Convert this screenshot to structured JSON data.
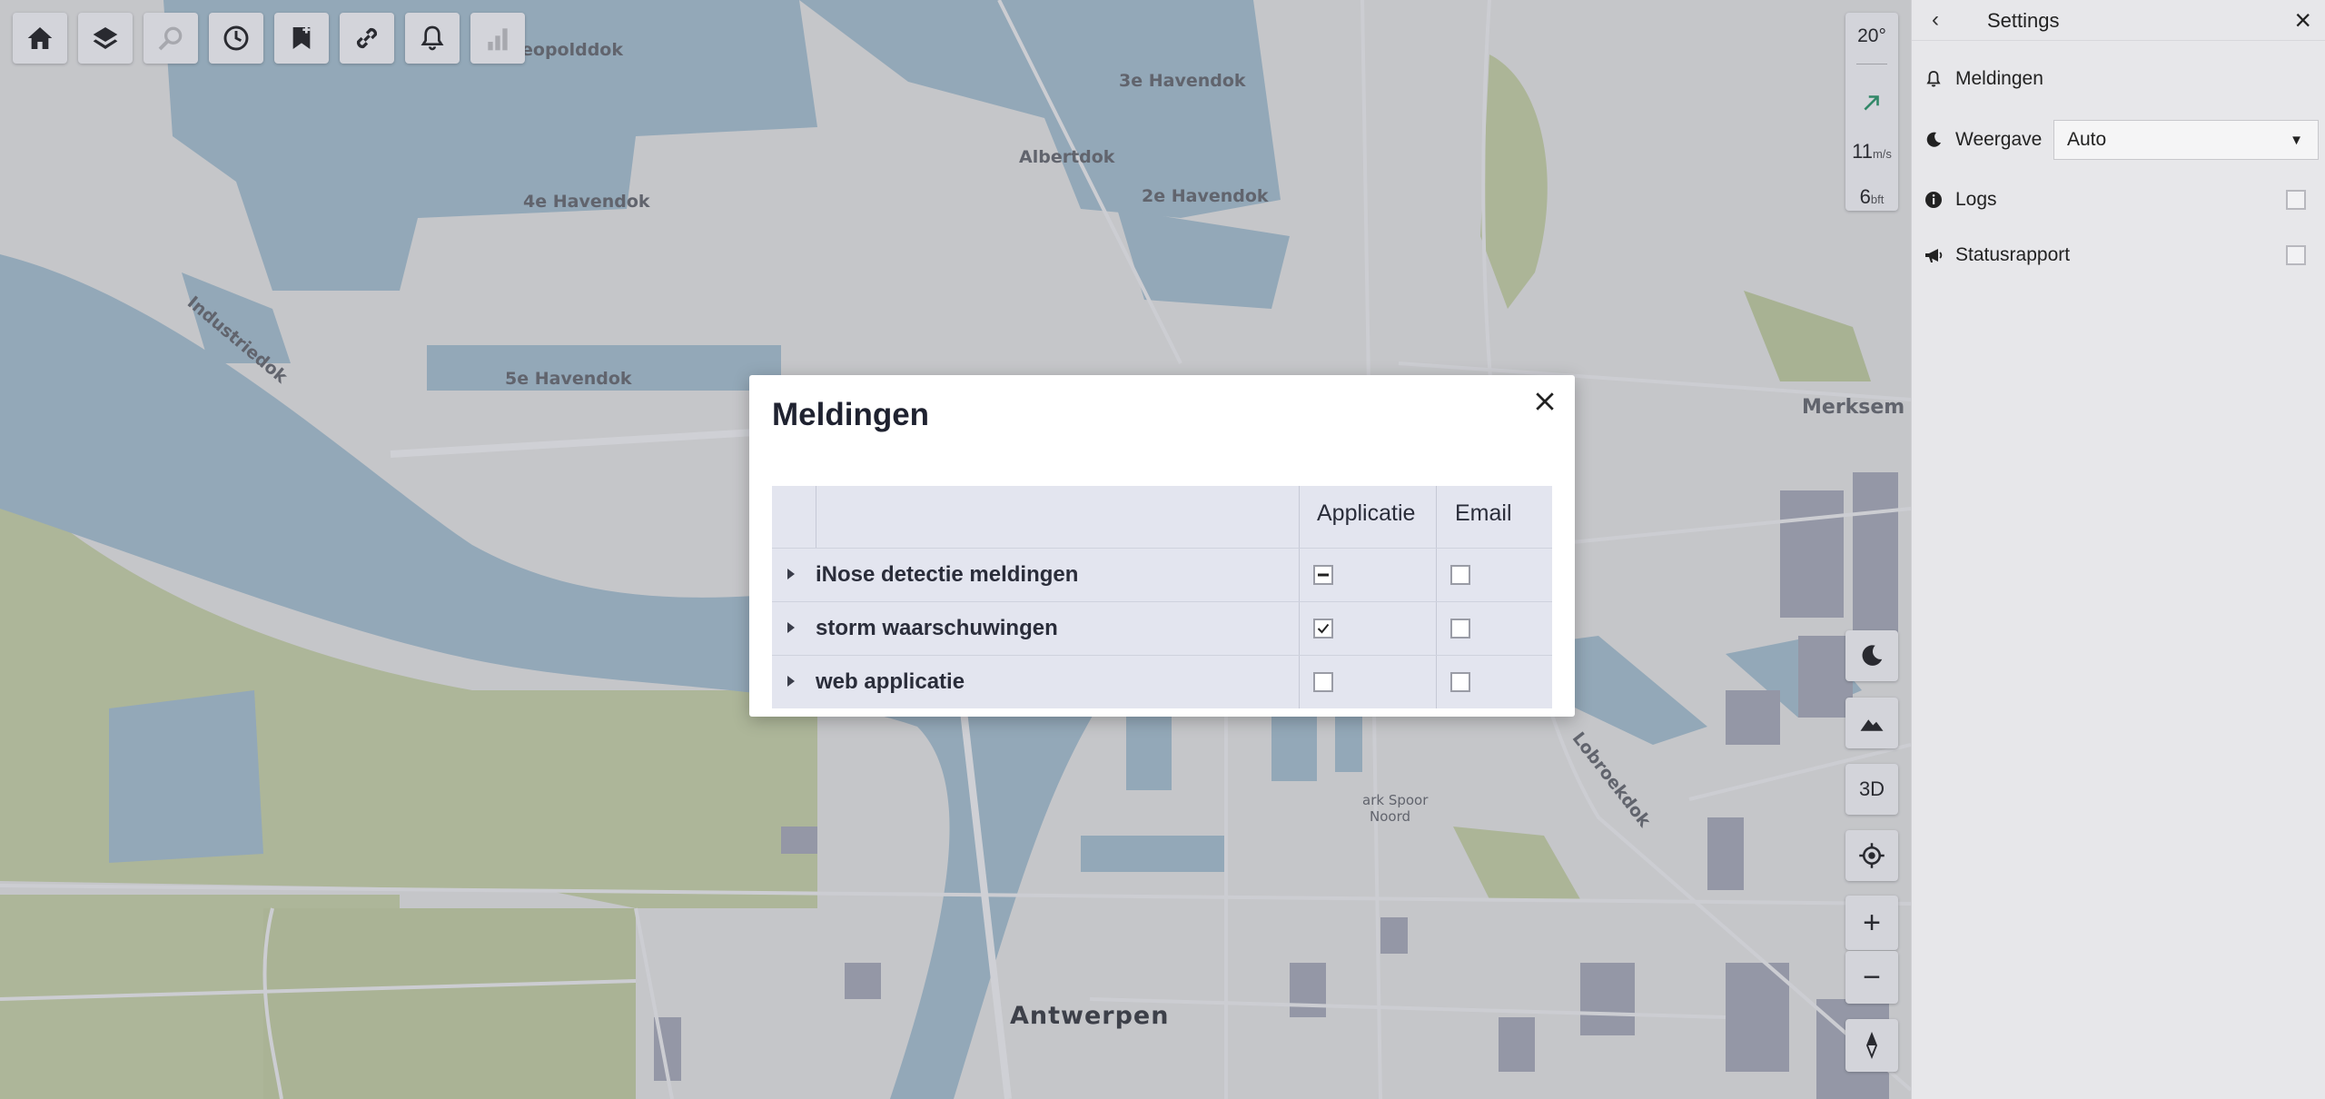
{
  "toolbar": {
    "buttons": [
      {
        "name": "home-icon",
        "enabled": true
      },
      {
        "name": "layers-icon",
        "enabled": true
      },
      {
        "name": "search-icon",
        "enabled": false
      },
      {
        "name": "clock-icon",
        "enabled": true
      },
      {
        "name": "bookmark-add-icon",
        "enabled": true
      },
      {
        "name": "link-icon",
        "enabled": true
      },
      {
        "name": "bell-icon",
        "enabled": true
      },
      {
        "name": "chart-icon",
        "enabled": false
      }
    ]
  },
  "weather": {
    "temperature": "20°",
    "wind_direction_icon": "arrow-up-right-icon",
    "wind_speed": "11",
    "wind_speed_unit": "m/s",
    "beaufort": "6",
    "beaufort_unit": "bft"
  },
  "map_controls": {
    "dark_mode_icon": "moon-icon",
    "terrain_icon": "mountain-icon",
    "three_d_label": "3D",
    "locate_icon": "crosshair-icon",
    "zoom_in_label": "+",
    "zoom_out_label": "−",
    "compass_icon": "compass-icon"
  },
  "map_labels": {
    "leopolddok": "eopolddok",
    "havendok3": "3e Havendok",
    "albertdok": "Albertdok",
    "havendok4": "4e Havendok",
    "havendok2": "2e Havendok",
    "industriedok": "Industriedok",
    "havendok5": "5e Havendok",
    "merksem": "Merksem",
    "lobroekdok": "Lobroekdok",
    "park_spoor_1": "ark Spoor",
    "park_spoor_2": "Noord",
    "antwerpen": "Antwerpen"
  },
  "settings_panel": {
    "title": "Settings",
    "back_icon": "chevron-left-icon",
    "close_icon": "close-icon",
    "items": [
      {
        "label": "Meldingen",
        "icon": "bell-icon"
      },
      {
        "label": "Weergave",
        "icon": "moon-icon",
        "select_value": "Auto"
      },
      {
        "label": "Logs",
        "icon": "info-icon",
        "checked": false
      },
      {
        "label": "Statusrapport",
        "icon": "megaphone-icon",
        "checked": false
      }
    ]
  },
  "modal": {
    "title": "Meldingen",
    "columns": [
      "Applicatie",
      "Email"
    ],
    "rows": [
      {
        "label": "iNose detectie meldingen",
        "applicatie": "indeterminate",
        "email": "unchecked"
      },
      {
        "label": "storm waarschuwingen",
        "applicatie": "checked",
        "email": "unchecked"
      },
      {
        "label": "web applicatie",
        "applicatie": "unchecked",
        "email": "unchecked"
      }
    ]
  },
  "colors": {
    "water": "#a7c2d0",
    "green": "#c5d1a1",
    "building": "#a9acb8",
    "overlay": "#464864"
  }
}
